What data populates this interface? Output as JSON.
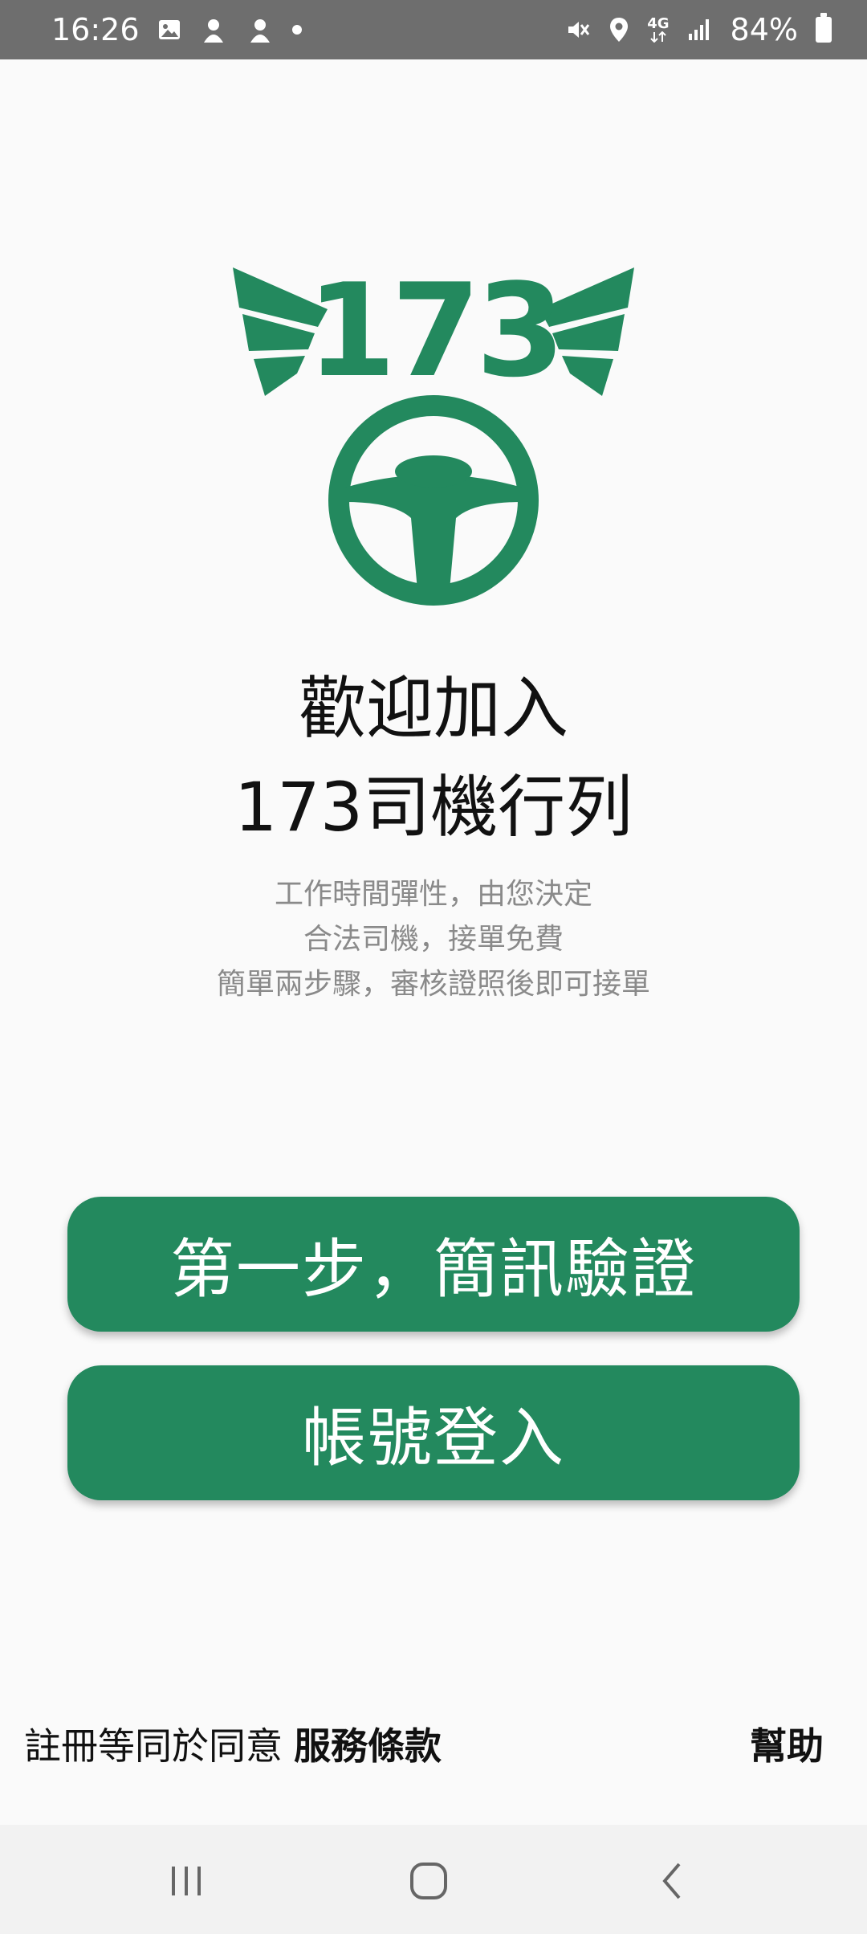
{
  "status_bar": {
    "time": "16:26",
    "battery": "84%",
    "network": "4G",
    "icons": [
      "image-icon",
      "app-notification-icon",
      "app-notification-icon",
      "dot-icon",
      "mute-icon",
      "location-icon",
      "network-4g-icon",
      "signal-icon",
      "battery-icon"
    ]
  },
  "logo": {
    "text": "173",
    "color": "#23895e"
  },
  "welcome": {
    "line1": "歡迎加入",
    "line2": "173司機行列"
  },
  "description": {
    "line1": "工作時間彈性，由您決定",
    "line2": "合法司機，接單免費",
    "line3": "簡單兩步驟，審核證照後即可接單"
  },
  "buttons": {
    "sms_verify": "第一步，簡訊驗證",
    "account_login": "帳號登入"
  },
  "footer": {
    "terms_prefix": "註冊等同於同意",
    "terms_link": "服務條款",
    "help": "幫助"
  },
  "colors": {
    "brand_green": "#23895e",
    "status_bar_bg": "#6e6e6e"
  }
}
